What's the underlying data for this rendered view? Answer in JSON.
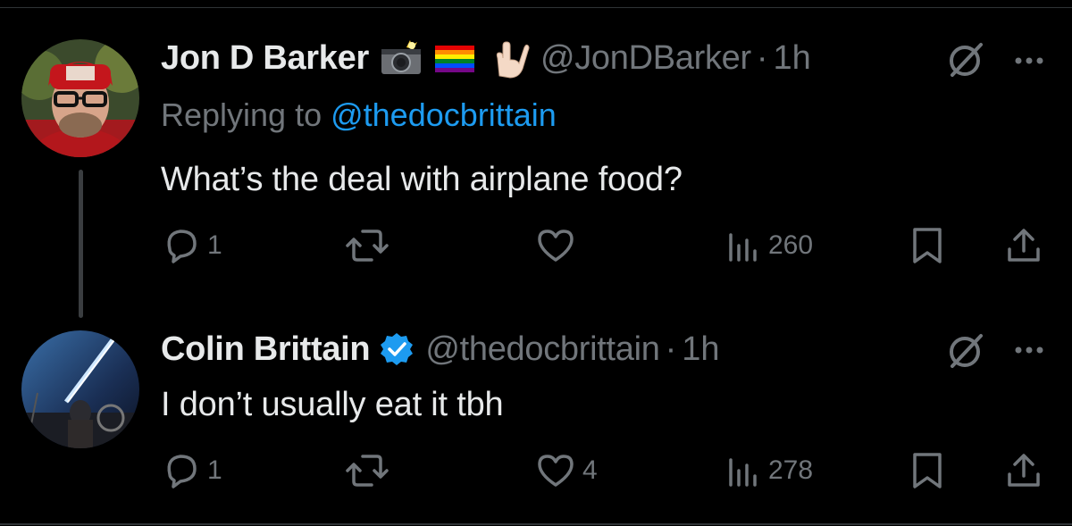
{
  "tweets": [
    {
      "author_name": "Jon D Barker",
      "emojis": [
        "📸",
        "🏳️‍🌈",
        "🤟🏻"
      ],
      "handle": "@JonDBarker",
      "separator": "·",
      "time": "1h",
      "replying_prefix": "Replying to ",
      "replying_to": "@thedocbrittain",
      "text": "What’s the deal with airplane food?",
      "replies": "1",
      "reposts": "",
      "likes": "",
      "views": "260",
      "verified": false
    },
    {
      "author_name": "Colin Brittain",
      "handle": "@thedocbrittain",
      "separator": "·",
      "time": "1h",
      "text": "I don’t usually eat it tbh",
      "replies": "1",
      "reposts": "",
      "likes": "4",
      "views": "278",
      "verified": true,
      "verified_color": "#1d9bf0"
    }
  ],
  "colors": {
    "background": "#000000",
    "text": "#e7e9ea",
    "muted": "#71767b",
    "accent": "#1d9bf0"
  },
  "icons": [
    "reply-icon",
    "repost-icon",
    "like-icon",
    "views-icon",
    "bookmark-icon",
    "share-icon",
    "grok-icon",
    "more-icon",
    "verified-badge-icon"
  ]
}
